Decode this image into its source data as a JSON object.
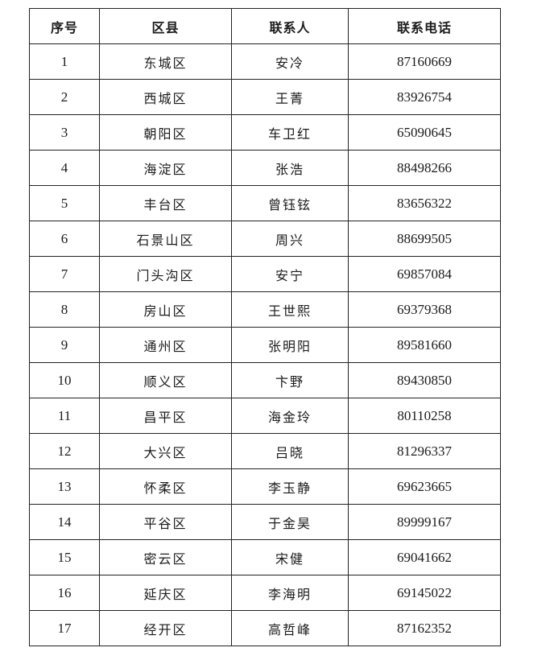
{
  "table": {
    "headers": [
      "序号",
      "区县",
      "联系人",
      "联系电话"
    ],
    "rows": [
      [
        "1",
        "东城区",
        "安冷",
        "87160669"
      ],
      [
        "2",
        "西城区",
        "王菁",
        "83926754"
      ],
      [
        "3",
        "朝阳区",
        "车卫红",
        "65090645"
      ],
      [
        "4",
        "海淀区",
        "张浩",
        "88498266"
      ],
      [
        "5",
        "丰台区",
        "曾钰铉",
        "83656322"
      ],
      [
        "6",
        "石景山区",
        "周兴",
        "88699505"
      ],
      [
        "7",
        "门头沟区",
        "安宁",
        "69857084"
      ],
      [
        "8",
        "房山区",
        "王世熙",
        "69379368"
      ],
      [
        "9",
        "通州区",
        "张明阳",
        "89581660"
      ],
      [
        "10",
        "顺义区",
        "卞野",
        "89430850"
      ],
      [
        "11",
        "昌平区",
        "海金玲",
        "80110258"
      ],
      [
        "12",
        "大兴区",
        "吕晓",
        "81296337"
      ],
      [
        "13",
        "怀柔区",
        "李玉静",
        "69623665"
      ],
      [
        "14",
        "平谷区",
        "于金昊",
        "89999167"
      ],
      [
        "15",
        "密云区",
        "宋健",
        "69041662"
      ],
      [
        "16",
        "延庆区",
        "李海明",
        "69145022"
      ],
      [
        "17",
        "经开区",
        "高哲峰",
        "87162352"
      ]
    ]
  }
}
